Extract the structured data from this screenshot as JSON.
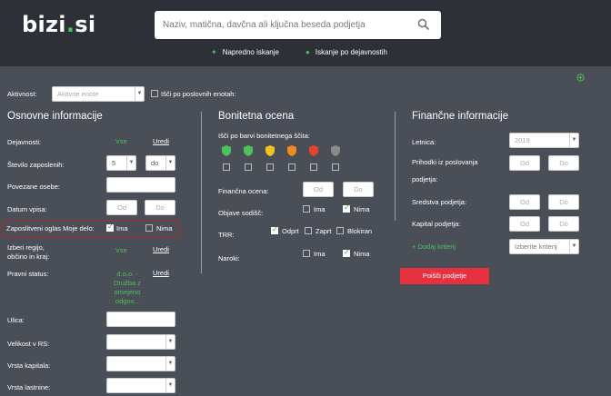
{
  "header": {
    "logo_main": "bizi",
    "logo_dot": ".",
    "logo_tld": "si",
    "search_placeholder": "Naziv, matična, davčna ali ključna beseda podjetja",
    "advanced_search": "Napredno iskanje",
    "activity_search": "Iskanje po dejavnostih"
  },
  "filters": {
    "activity_label": "Aktivnost:",
    "activity_placeholder": "Aktivne enote",
    "search_units_label": "Išči po poslovnih enotah:"
  },
  "basic": {
    "title": "Osnovne informacije",
    "activities_label": "Dejavnosti:",
    "activities_value": "Vse",
    "activities_link": "Uredi",
    "employees_label": "Število zaposlenih:",
    "employees_from": "5",
    "employees_to": "do",
    "related_label": "Povezane osebe:",
    "entry_label": "Datum vpisa:",
    "from_ph": "Od",
    "to_ph": "Do",
    "job_ad_label": "Zaposlitveni oglas Moje delo:",
    "yes": "Ima",
    "no": "Nima",
    "region_label_1": "Izberi regijo,",
    "region_label_2": "občino in kraj:",
    "region_value": "Vse",
    "region_link": "Uredi",
    "legal_label": "Pravni status:",
    "legal_value_1": "d.o.o. -",
    "legal_value_2": "Družba z",
    "legal_value_3": "omejeno",
    "legal_value_4": "odgov...",
    "legal_link": "Uredi",
    "street_label": "Ulica:",
    "size_label": "Velikost v RS:",
    "capital_type_label": "Vrsta kapitala:",
    "ownership_label": "Vrsta lastnine:"
  },
  "credit": {
    "title": "Bonitetna ocena",
    "color_label": "Išči po barvi bonitetnega ščita:",
    "shield_colors": [
      "#4cc35a",
      "#4cc35a",
      "#f2c21a",
      "#f28b1a",
      "#e8432a",
      "#8a8a8a"
    ],
    "fin_rating_label": "Finančna ocena:",
    "from_ph": "Od",
    "to_ph": "Do",
    "blockades_label": "Objave sodišč:",
    "yes": "Ima",
    "no": "Nima",
    "trr_label": "TRR:",
    "trr_open": "Odprt",
    "trr_closed": "Zaprt",
    "trr_blocked": "Blokiran",
    "orders_label": "Naroki:"
  },
  "financial": {
    "title": "Finančne informacije",
    "year_label": "Letnica:",
    "year_value": "2019",
    "revenue_label_1": "Prihodki iz poslovanja",
    "revenue_label_2": "podjetja:",
    "assets_label": "Sredstva podjetja:",
    "capital_label": "Kapital podjetja:",
    "from_ph": "Od",
    "to_ph": "Do",
    "add_criterion": "+ Dodaj kriterij",
    "criterion_placeholder": "Izberite kriterij",
    "search_button": "Poišči podjetje"
  }
}
